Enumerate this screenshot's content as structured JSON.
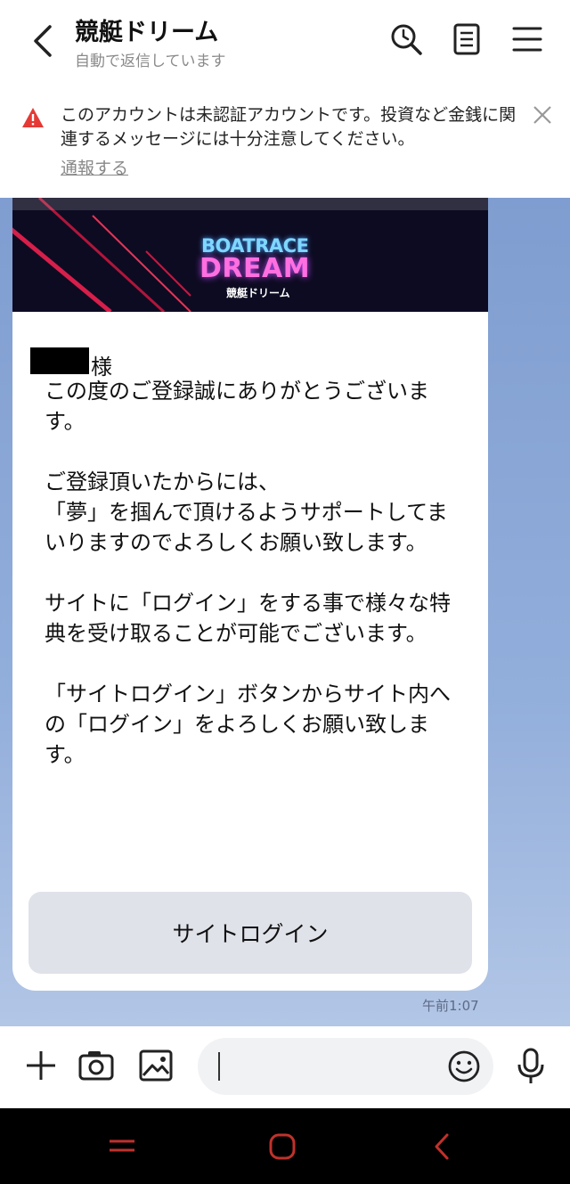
{
  "header": {
    "title": "競艇ドリーム",
    "subtitle": "自動で返信しています",
    "icons": [
      "back-icon",
      "search-icon",
      "notes-icon",
      "menu-icon"
    ]
  },
  "notice": {
    "text": "このアカウントは未認証アカウントです。投資など金銭に関連するメッセージには十分注意してください。",
    "report_label": "通報する",
    "warn_color": "#e53935"
  },
  "message": {
    "banner": {
      "line1": "BOATRACE",
      "line2": "DREAM",
      "line3": "競艇ドリーム"
    },
    "salutation": "様",
    "body": "この度のご登録誠にありがとうございます。\n\nご登録頂いたからには、\n「夢」を掴んで頂けるようサポートしてまいりますのでよろしくお願い致します。\n\nサイトに「ログイン」をする事で様々な特典を受け取ることが可能でございます。\n\n「サイトログイン」ボタンからサイト内への「ログイン」をよろしくお願い致します。",
    "button_label": "サイトログイン",
    "time": "午前1:07"
  },
  "input": {
    "placeholder": "",
    "icons": [
      "plus-icon",
      "camera-icon",
      "image-icon",
      "emoji-icon",
      "mic-icon"
    ]
  },
  "nav": {
    "icons": [
      "recent-apps-icon",
      "home-icon",
      "back-nav-icon"
    ],
    "color": "#c0312b"
  }
}
